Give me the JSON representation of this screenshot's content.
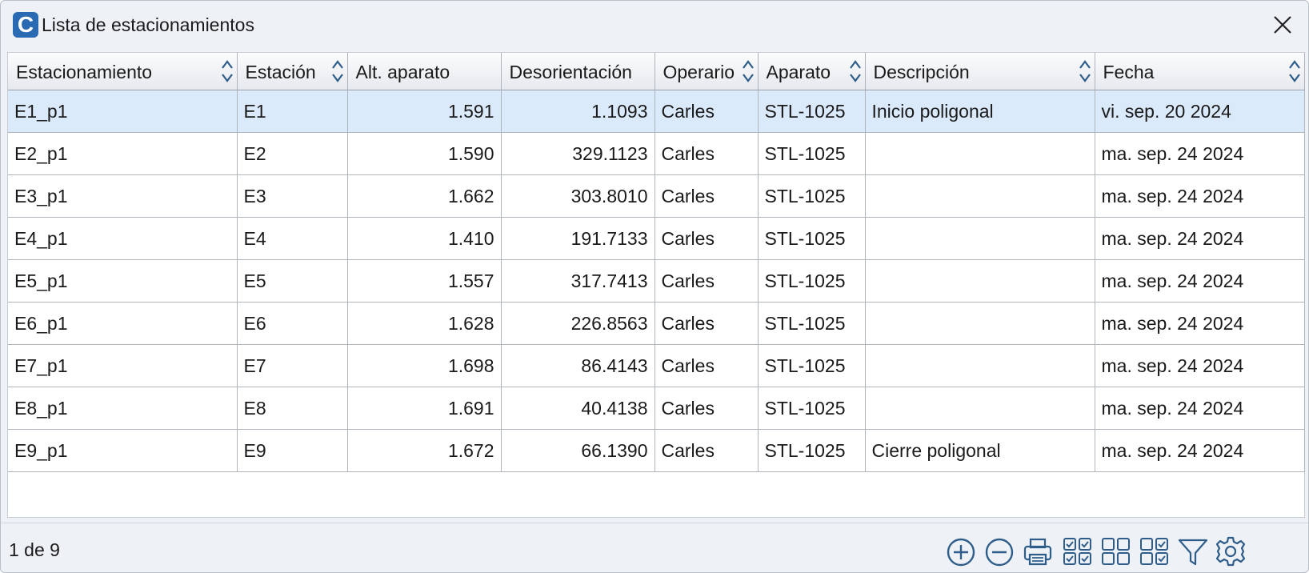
{
  "window": {
    "title": "Lista de estacionamientos",
    "app_icon_letter": "C"
  },
  "colors": {
    "accent": "#2a6ab2",
    "selected_row": "#dbeafb",
    "icon_stroke": "#2f5d8a"
  },
  "table": {
    "columns": [
      {
        "label": "Estacionamiento",
        "sortable": true
      },
      {
        "label": "Estación",
        "sortable": true
      },
      {
        "label": "Alt. aparato",
        "sortable": false
      },
      {
        "label": "Desorientación",
        "sortable": false
      },
      {
        "label": "Operario",
        "sortable": true
      },
      {
        "label": "Aparato",
        "sortable": true
      },
      {
        "label": "Descripción",
        "sortable": true
      },
      {
        "label": "Fecha",
        "sortable": true
      }
    ],
    "rows": [
      {
        "selected": true,
        "cells": [
          "E1_p1",
          "E1",
          "1.591",
          "1.1093",
          "Carles",
          "STL-1025",
          "Inicio poligonal",
          "vi. sep. 20 2024"
        ]
      },
      {
        "selected": false,
        "cells": [
          "E2_p1",
          "E2",
          "1.590",
          "329.1123",
          "Carles",
          "STL-1025",
          "",
          "ma. sep. 24 2024"
        ]
      },
      {
        "selected": false,
        "cells": [
          "E3_p1",
          "E3",
          "1.662",
          "303.8010",
          "Carles",
          "STL-1025",
          "",
          "ma. sep. 24 2024"
        ]
      },
      {
        "selected": false,
        "cells": [
          "E4_p1",
          "E4",
          "1.410",
          "191.7133",
          "Carles",
          "STL-1025",
          "",
          "ma. sep. 24 2024"
        ]
      },
      {
        "selected": false,
        "cells": [
          "E5_p1",
          "E5",
          "1.557",
          "317.7413",
          "Carles",
          "STL-1025",
          "",
          "ma. sep. 24 2024"
        ]
      },
      {
        "selected": false,
        "cells": [
          "E6_p1",
          "E6",
          "1.628",
          "226.8563",
          "Carles",
          "STL-1025",
          "",
          "ma. sep. 24 2024"
        ]
      },
      {
        "selected": false,
        "cells": [
          "E7_p1",
          "E7",
          "1.698",
          "86.4143",
          "Carles",
          "STL-1025",
          "",
          "ma. sep. 24 2024"
        ]
      },
      {
        "selected": false,
        "cells": [
          "E8_p1",
          "E8",
          "1.691",
          "40.4138",
          "Carles",
          "STL-1025",
          "",
          "ma. sep. 24 2024"
        ]
      },
      {
        "selected": false,
        "cells": [
          "E9_p1",
          "E9",
          "1.672",
          "66.1390",
          "Carles",
          "STL-1025",
          "Cierre poligonal",
          "ma. sep. 24 2024"
        ]
      }
    ]
  },
  "statusbar": {
    "record_position": "1 de 9"
  },
  "toolbar": {
    "icons": [
      "add-icon",
      "remove-icon",
      "print-icon",
      "check-all-icon",
      "uncheck-all-icon",
      "invert-check-icon",
      "filter-icon",
      "settings-icon"
    ]
  }
}
